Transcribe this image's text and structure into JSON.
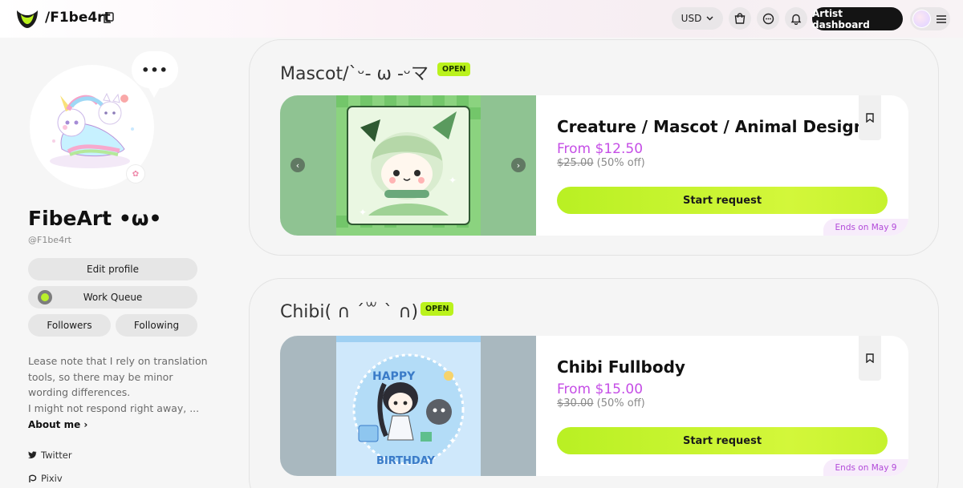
{
  "header": {
    "handle": "/F1be4rt",
    "currency": "USD",
    "artist_dashboard": "Artist dashboard"
  },
  "sidebar": {
    "more": "•••",
    "display_name": "FibeArt •ω•",
    "username": "@F1be4rt",
    "edit_profile": "Edit profile",
    "work_queue": "Work Queue",
    "followers": "Followers",
    "following": "Following",
    "bio_lines": [
      "Lease note that I rely on translation",
      "tools, so there may be minor",
      "wording differences.",
      "I might not respond right away, ..."
    ],
    "about_me": "About me ›",
    "socials": [
      {
        "label": "Twitter",
        "icon": "twitter-icon"
      },
      {
        "label": "Pixiv",
        "icon": "pixiv-icon"
      }
    ]
  },
  "sections": [
    {
      "title": "Mascot/`ᵕ- ω -ᵕマ",
      "status": "OPEN",
      "card": {
        "title": "Creature / Mascot / Animal Design",
        "price": "From $12.50",
        "old_price": "$25.00",
        "discount": "(50% off)",
        "cta": "Start request",
        "ends": "Ends on May 9"
      }
    },
    {
      "title": "Chibi( ∩ ´꒳ ` ∩)",
      "status": "OPEN",
      "card": {
        "title": "Chibi Fullbody",
        "price": "From $15.00",
        "old_price": "$30.00",
        "discount": "(50% off)",
        "cta": "Start request",
        "ends": "Ends on May 9"
      }
    }
  ],
  "colors": {
    "accent_green": "#baf21c",
    "price_purple": "#c54ee6",
    "dark_button": "#141414"
  }
}
